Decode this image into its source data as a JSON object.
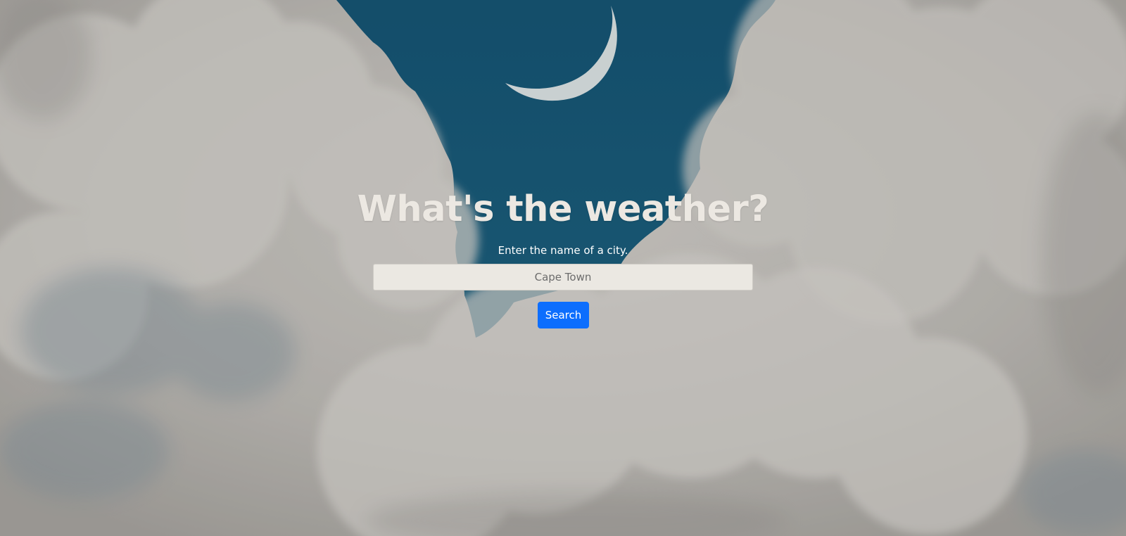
{
  "page": {
    "heading": "What's the weather?",
    "subtitle": "Enter the name of a city."
  },
  "search": {
    "placeholder": "Cape Town",
    "value": "",
    "button_label": "Search"
  },
  "colors": {
    "sky": "#0b4d6e",
    "cloud": "#bdbab6",
    "button": "#0d6efd",
    "input_bg": "#ebe8e2",
    "heading": "#ece8e2"
  },
  "background": {
    "icon": "crescent-moon-icon"
  }
}
